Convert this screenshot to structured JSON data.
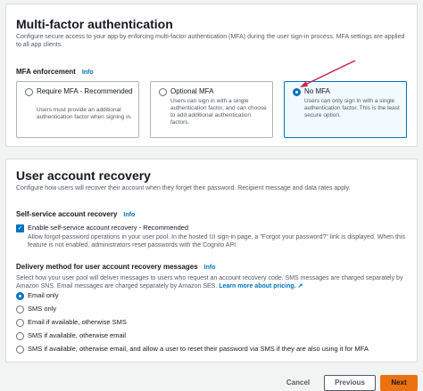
{
  "mfa": {
    "title": "Multi-factor authentication",
    "description": "Configure secure access to your app by enforcing multi-factor authentication (MFA) during the user sign-in process. MFA settings are applied to all app clients.",
    "enforcement_label": "MFA enforcement",
    "info": "Info",
    "options": [
      {
        "title": "Require MFA - Recommended",
        "description": "Users must provide an additional authentication factor when signing in.",
        "selected": false
      },
      {
        "title": "Optional MFA",
        "description": "Users can sign in with a single authentication factor, and can choose to add additional authentication factors.",
        "selected": false
      },
      {
        "title": "No MFA",
        "description": "Users can only sign in with a single authentication factor. This is the least secure option.",
        "selected": true
      }
    ]
  },
  "recovery": {
    "title": "User account recovery",
    "description": "Configure how users will recover their account when they forget their password. Recipient message and data rates apply.",
    "self_service_label": "Self-service account recovery",
    "info": "Info",
    "checkbox_label": "Enable self-service account recovery - Recommended",
    "checkbox_checked": true,
    "checkbox_description": "Allow forgot-password operations in your user pool. In the hosted UI sign-in page, a \"Forgot your password?\" link is displayed. When this feature is not enabled, administrators reset passwords with the Cognito API.",
    "delivery_label": "Delivery method for user account recovery messages",
    "delivery_description": "Select how your user pool will deliver messages to users who request an account recovery code. SMS messages are charged separately by Amazon SNS. Email messages are charged separately by Amazon SES.",
    "learn_more": "Learn more about pricing.",
    "delivery_options": [
      {
        "label": "Email only",
        "selected": true
      },
      {
        "label": "SMS only",
        "selected": false
      },
      {
        "label": "Email if available, otherwise SMS",
        "selected": false
      },
      {
        "label": "SMS if available, otherwise email",
        "selected": false
      },
      {
        "label": "SMS if available, otherwise email, and allow a user to reset their password via SMS if they are also using it for MFA",
        "selected": false
      }
    ]
  },
  "footer": {
    "cancel": "Cancel",
    "previous": "Previous",
    "next": "Next"
  },
  "colors": {
    "accent": "#0073bb",
    "primary_button": "#ec7211",
    "annotation_arrow": "#c7254e"
  }
}
